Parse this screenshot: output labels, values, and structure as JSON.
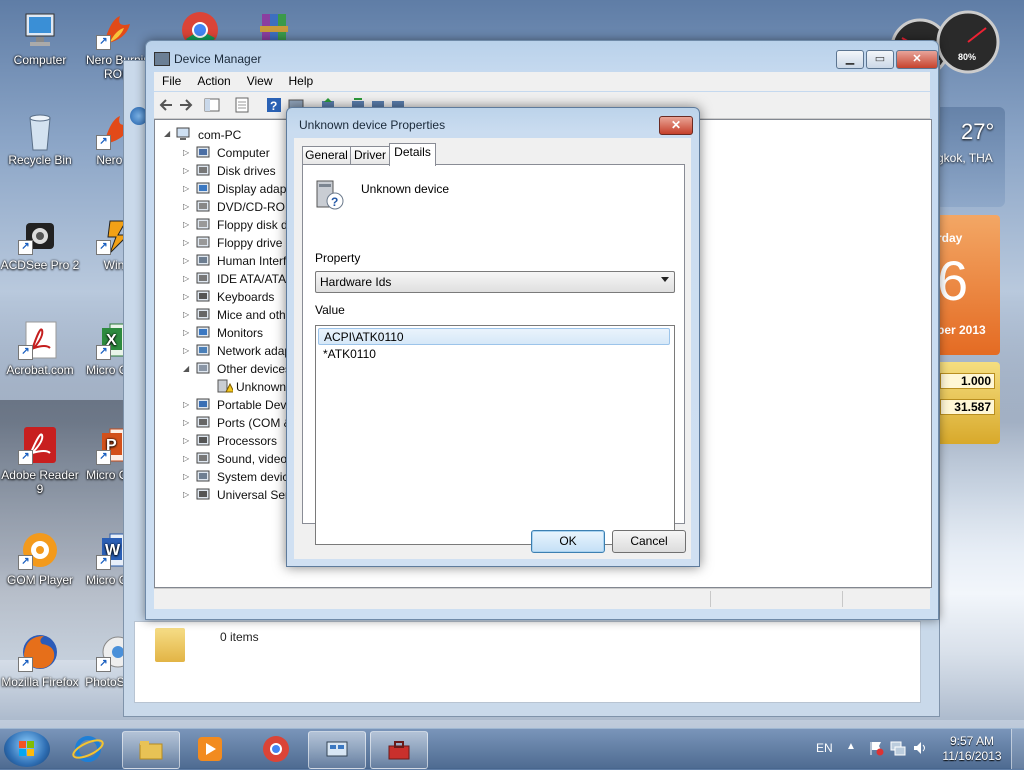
{
  "desktop": {
    "icons": [
      {
        "label": "Computer"
      },
      {
        "label": "Nero Burnin ROM"
      },
      {
        "label": "Recycle Bin"
      },
      {
        "label": "Nero Ex"
      },
      {
        "label": "ACDSee Pro 2"
      },
      {
        "label": "WinA"
      },
      {
        "label": "Acrobat.com"
      },
      {
        "label": "Micro Office"
      },
      {
        "label": "Adobe Reader 9"
      },
      {
        "label": "Micro Office"
      },
      {
        "label": "GOM Player"
      },
      {
        "label": "Micro Office"
      },
      {
        "label": "Mozilla Firefox"
      },
      {
        "label": "PhotoScape"
      }
    ]
  },
  "gadgets": {
    "meter_percent": "80%",
    "weather_temp": "27°",
    "weather_city": "gkok, THA",
    "calendar_day": "rday",
    "calendar_date": "6",
    "calendar_month": "ber 2013",
    "currency_row1": "1.000",
    "currency_row2": "31.587"
  },
  "device_manager": {
    "title": "Device Manager",
    "menu": [
      "File",
      "Action",
      "View",
      "Help"
    ],
    "tree_root": "com-PC",
    "tree_items": [
      {
        "label": "Computer",
        "expander": "▷"
      },
      {
        "label": "Disk drives",
        "expander": "▷"
      },
      {
        "label": "Display adapt",
        "expander": "▷"
      },
      {
        "label": "DVD/CD-ROM",
        "expander": "▷"
      },
      {
        "label": "Floppy disk d",
        "expander": "▷"
      },
      {
        "label": "Floppy drive c",
        "expander": "▷"
      },
      {
        "label": "Human Interf",
        "expander": "▷"
      },
      {
        "label": "IDE ATA/ATA",
        "expander": "▷"
      },
      {
        "label": "Keyboards",
        "expander": "▷"
      },
      {
        "label": "Mice and oth",
        "expander": "▷"
      },
      {
        "label": "Monitors",
        "expander": "▷"
      },
      {
        "label": "Network adap",
        "expander": "▷"
      },
      {
        "label": "Other devices",
        "expander": "◢"
      },
      {
        "label": "Unknown",
        "expander": ""
      },
      {
        "label": "Portable Devi",
        "expander": "▷"
      },
      {
        "label": "Ports (COM &",
        "expander": "▷"
      },
      {
        "label": "Processors",
        "expander": "▷"
      },
      {
        "label": "Sound, video",
        "expander": "▷"
      },
      {
        "label": "System device",
        "expander": "▷"
      },
      {
        "label": "Universal Seri",
        "expander": "▷"
      }
    ]
  },
  "explorer": {
    "status": "0 items"
  },
  "dialog": {
    "title": "Unknown device Properties",
    "close_label": "✕",
    "tabs": [
      "General",
      "Driver",
      "Details"
    ],
    "active_tab": "Details",
    "device_name": "Unknown device",
    "property_label": "Property",
    "property_value": "Hardware Ids",
    "value_label": "Value",
    "values": [
      "ACPI\\ATK0110",
      "*ATK0110"
    ],
    "selected_value_index": 0,
    "ok_label": "OK",
    "cancel_label": "Cancel"
  },
  "taskbar": {
    "language": "EN",
    "time": "9:57 AM",
    "date": "11/16/2013"
  },
  "colors": {
    "accent": "#3c7fb1",
    "selection": "#d6e8f8",
    "close_red": "#c5402b"
  }
}
